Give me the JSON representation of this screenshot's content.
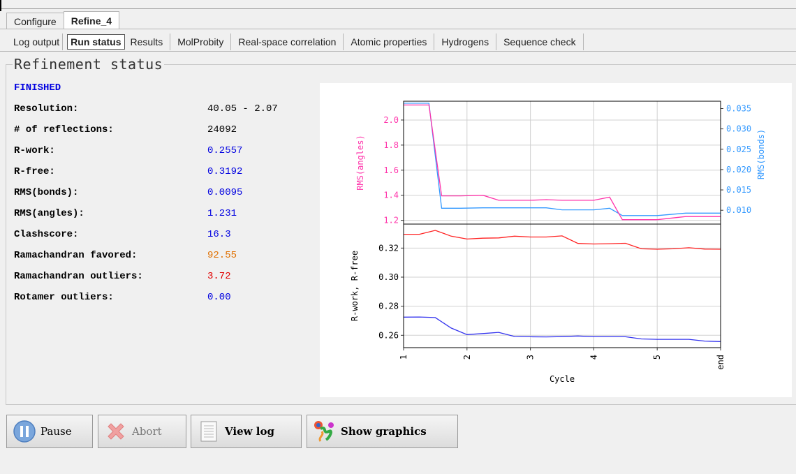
{
  "tabs_top": [
    "Configure",
    "Refine_4"
  ],
  "tabs_sub": [
    "Log output",
    "Run status",
    "Results",
    "MolProbity",
    "Real-space correlation",
    "Atomic properties",
    "Hydrogens",
    "Sequence check"
  ],
  "group_title": "Refinement status",
  "status": "FINISHED",
  "stats": [
    {
      "label": "Resolution:",
      "value": "40.05 - 2.07",
      "color": "#000000"
    },
    {
      "label": "# of reflections:",
      "value": "24092",
      "color": "#000000"
    },
    {
      "label": "R-work:",
      "value": "0.2557",
      "color": "#0000e0"
    },
    {
      "label": "R-free:",
      "value": "0.3192",
      "color": "#0000e0"
    },
    {
      "label": "RMS(bonds):",
      "value": "0.0095",
      "color": "#0000e0"
    },
    {
      "label": "RMS(angles):",
      "value": "1.231",
      "color": "#0000e0"
    },
    {
      "label": "Clashscore:",
      "value": "16.3",
      "color": "#0000e0"
    },
    {
      "label": "Ramachandran favored:",
      "value": "92.55",
      "color": "#e07000"
    },
    {
      "label": "Ramachandran outliers:",
      "value": "3.72",
      "color": "#e00000"
    },
    {
      "label": "Rotamer outliers:",
      "value": "0.00",
      "color": "#0000e0"
    }
  ],
  "buttons": {
    "pause": "Pause",
    "abort": "Abort",
    "view_log": "View log",
    "show_graphics": "Show graphics"
  },
  "chart_data": [
    {
      "type": "line",
      "ylabel": "RMS(angles)",
      "ylabel2": "RMS(bonds)",
      "x": [
        1,
        1.25,
        1.4,
        1.6,
        1.9,
        2.25,
        2.5,
        3.0,
        3.25,
        3.5,
        4.0,
        4.25,
        4.45,
        5.0,
        5.45,
        6.0
      ],
      "ylim": [
        1.17,
        2.15
      ],
      "y2lim": [
        0.0066,
        0.0368
      ],
      "yticks": [
        "2.0",
        "1.8",
        "1.6",
        "1.4",
        "1.2"
      ],
      "y2ticks": [
        "0.035",
        "0.030",
        "0.025",
        "0.020",
        "0.015",
        "0.010"
      ],
      "series": [
        {
          "name": "RMS(angles)",
          "color": "#ff33aa",
          "values": [
            2.12,
            2.12,
            2.12,
            1.395,
            1.395,
            1.4,
            1.36,
            1.36,
            1.365,
            1.36,
            1.36,
            1.385,
            1.205,
            1.205,
            1.23,
            1.23
          ]
        },
        {
          "name": "RMS(bonds)",
          "color": "#3399ff",
          "axis": "right",
          "values": [
            0.0363,
            0.0363,
            0.0363,
            0.0105,
            0.0105,
            0.0106,
            0.0106,
            0.0106,
            0.0106,
            0.0101,
            0.0101,
            0.0105,
            0.0087,
            0.0087,
            0.0093,
            0.0093
          ]
        }
      ]
    },
    {
      "type": "line",
      "xlabel": "Cycle",
      "ylabel": "R-work, R-free",
      "x": [
        1,
        1.25,
        1.5,
        1.75,
        2.0,
        2.25,
        2.5,
        2.75,
        3.0,
        3.25,
        3.5,
        3.75,
        4.0,
        4.25,
        4.5,
        4.75,
        5.0,
        5.25,
        5.5,
        5.75,
        6.0
      ],
      "xticks": [
        "1",
        "2",
        "3",
        "4",
        "5",
        "end"
      ],
      "ylim": [
        0.2515,
        0.3365
      ],
      "yticks": [
        "0.32",
        "0.30",
        "0.28",
        "0.26"
      ],
      "series": [
        {
          "name": "R-free",
          "color": "#ff2222",
          "values": [
            0.3295,
            0.3295,
            0.3322,
            0.3282,
            0.3262,
            0.3268,
            0.327,
            0.3282,
            0.3276,
            0.3276,
            0.3284,
            0.3232,
            0.3228,
            0.323,
            0.3233,
            0.3195,
            0.3192,
            0.3195,
            0.3202,
            0.3193,
            0.3192
          ]
        },
        {
          "name": "R-work",
          "color": "#3333ee",
          "values": [
            0.2725,
            0.2726,
            0.2722,
            0.265,
            0.2605,
            0.2612,
            0.262,
            0.2592,
            0.259,
            0.2589,
            0.2591,
            0.2595,
            0.259,
            0.259,
            0.259,
            0.2575,
            0.2572,
            0.2572,
            0.2572,
            0.256,
            0.2557
          ]
        }
      ]
    }
  ]
}
